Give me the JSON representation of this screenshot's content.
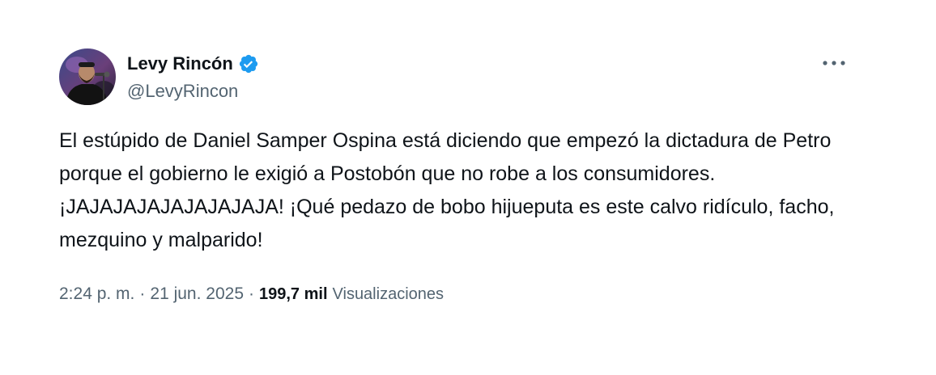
{
  "author": {
    "display_name": "Levy Rincón",
    "handle": "@LevyRincon",
    "verified": true
  },
  "icons": {
    "avatar": "profile-photo",
    "verified": "verified-badge-icon",
    "more": "more-options-icon"
  },
  "colors": {
    "verified_badge": "#1d9bf0",
    "secondary_text": "#536471",
    "primary_text": "#0f1419"
  },
  "tweet": {
    "text": "El estúpido de Daniel Samper Ospina está diciendo que empezó la dictadura de Petro porque el gobierno le exigió a Postobón que no robe a los consumidores. ¡JAJAJAJAJAJAJAJAJA! ¡Qué pedazo de bobo hijueputa es este calvo ridículo, facho, mezquino y malparido!"
  },
  "meta": {
    "time": "2:24 p. m.",
    "separator": "·",
    "date": "21 jun. 2025",
    "views_count": "199,7 mil",
    "views_label": "Visualizaciones"
  }
}
